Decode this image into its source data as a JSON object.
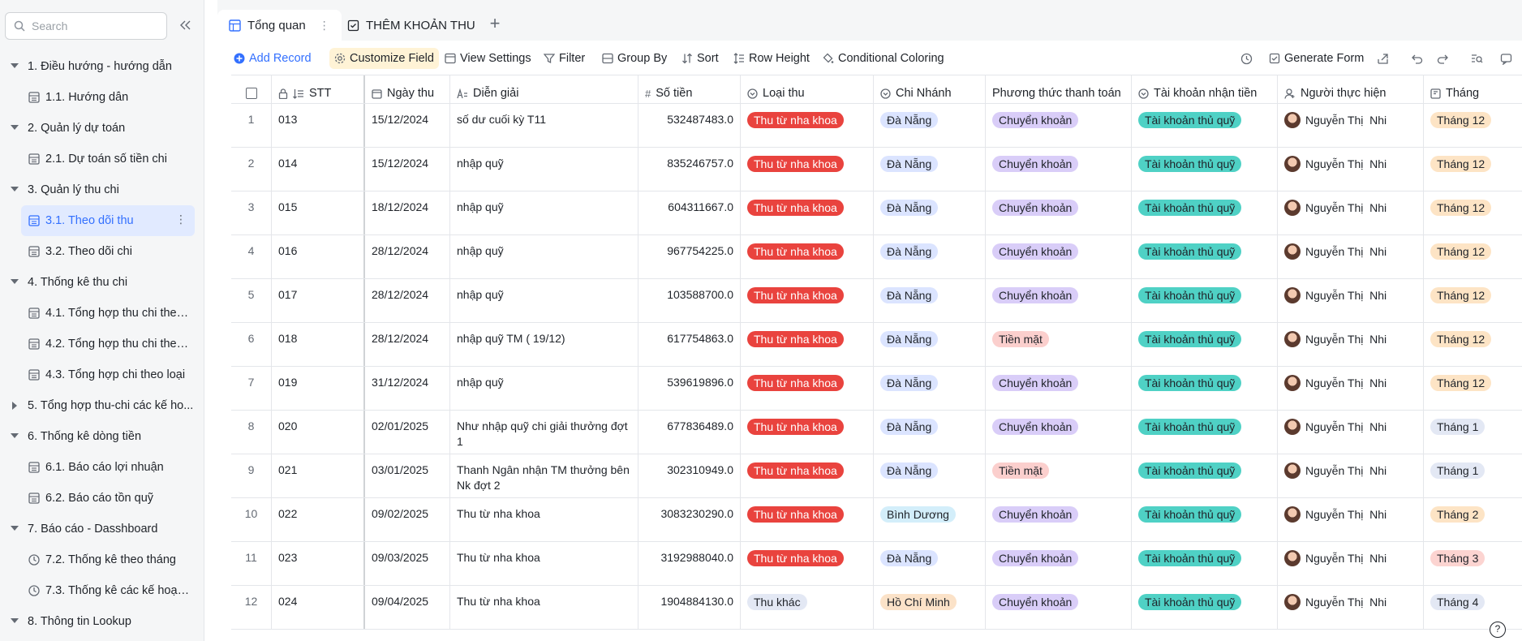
{
  "sidebar": {
    "search_placeholder": "Search",
    "items": [
      {
        "type": "group",
        "label": "1. Điều hướng - hướng dẫn",
        "expanded": true
      },
      {
        "type": "child",
        "label": "1.1. Hướng dẫn",
        "icon": "grid-icon"
      },
      {
        "type": "group",
        "label": "2. Quản lý dự toán",
        "expanded": true
      },
      {
        "type": "child",
        "label": "2.1. Dự toán số tiền chi",
        "icon": "grid-icon"
      },
      {
        "type": "group",
        "label": "3. Quản lý thu chi",
        "expanded": true
      },
      {
        "type": "child",
        "label": "3.1. Theo dõi thu",
        "icon": "grid-icon",
        "active": true
      },
      {
        "type": "child",
        "label": "3.2. Theo dõi chi",
        "icon": "grid-icon"
      },
      {
        "type": "group",
        "label": "4. Thống kê thu chi",
        "expanded": true
      },
      {
        "type": "child",
        "label": "4.1. Tổng hợp thu chi theo...",
        "icon": "grid-icon"
      },
      {
        "type": "child",
        "label": "4.2. Tổng hợp thu chi theo...",
        "icon": "grid-icon"
      },
      {
        "type": "child",
        "label": "4.3. Tổng hợp chi theo loại",
        "icon": "grid-icon"
      },
      {
        "type": "group",
        "label": "5. Tổng hợp thu-chi các kế ho...",
        "expanded": false
      },
      {
        "type": "group",
        "label": "6. Thống kê dòng tiền",
        "expanded": true
      },
      {
        "type": "child",
        "label": "6.1. Báo cáo lợi nhuận",
        "icon": "grid-icon"
      },
      {
        "type": "child",
        "label": "6.2. Báo cáo tồn quỹ",
        "icon": "grid-icon"
      },
      {
        "type": "group",
        "label": "7. Báo cáo - Dasshboard",
        "expanded": true
      },
      {
        "type": "child",
        "label": "7.2. Thống kê theo tháng",
        "icon": "dashboard-icon"
      },
      {
        "type": "child",
        "label": "7.3. Thống kê các kế hoạc...",
        "icon": "dashboard-icon"
      },
      {
        "type": "group",
        "label": "8. Thông tin Lookup",
        "expanded": true
      }
    ]
  },
  "tabs": [
    {
      "label": "Tổng quan",
      "active": true
    },
    {
      "label": "THÊM KHOẢN THU",
      "active": false
    }
  ],
  "toolbar": {
    "add_record": "Add Record",
    "customize_field": "Customize Field",
    "view_settings": "View Settings",
    "filter": "Filter",
    "group_by": "Group By",
    "sort": "Sort",
    "row_height": "Row Height",
    "conditional_coloring": "Conditional Coloring",
    "generate_form": "Generate Form"
  },
  "table": {
    "columns": [
      "STT",
      "Ngày thu",
      "Diễn giải",
      "Số tiền",
      "Loại thu",
      "Chi Nhánh",
      "Phương thức thanh toán",
      "Tài khoản nhận tiền",
      "Người thực hiện",
      "Tháng"
    ],
    "rows": [
      {
        "idx": "1",
        "stt": "013",
        "date": "15/12/2024",
        "desc": "số dư cuối kỳ T11",
        "amount": "532487483.0",
        "type": "Thu từ nha khoa",
        "branch": "Đà Nẵng",
        "method": "Chuyển khoản",
        "account": "Tài khoản thủ quỹ",
        "person": "Nguyễn Thị  Nhi",
        "month": "Tháng 12"
      },
      {
        "idx": "2",
        "stt": "014",
        "date": "15/12/2024",
        "desc": "nhập quỹ",
        "amount": "835246757.0",
        "type": "Thu từ nha khoa",
        "branch": "Đà Nẵng",
        "method": "Chuyển khoản",
        "account": "Tài khoản thủ quỹ",
        "person": "Nguyễn Thị  Nhi",
        "month": "Tháng 12"
      },
      {
        "idx": "3",
        "stt": "015",
        "date": "18/12/2024",
        "desc": "nhập quỹ",
        "amount": "604311667.0",
        "type": "Thu từ nha khoa",
        "branch": "Đà Nẵng",
        "method": "Chuyển khoản",
        "account": "Tài khoản thủ quỹ",
        "person": "Nguyễn Thị  Nhi",
        "month": "Tháng 12"
      },
      {
        "idx": "4",
        "stt": "016",
        "date": "28/12/2024",
        "desc": "nhập quỹ",
        "amount": "967754225.0",
        "type": "Thu từ nha khoa",
        "branch": "Đà Nẵng",
        "method": "Chuyển khoản",
        "account": "Tài khoản thủ quỹ",
        "person": "Nguyễn Thị  Nhi",
        "month": "Tháng 12"
      },
      {
        "idx": "5",
        "stt": "017",
        "date": "28/12/2024",
        "desc": "nhập quỹ",
        "amount": "103588700.0",
        "type": "Thu từ nha khoa",
        "branch": "Đà Nẵng",
        "method": "Chuyển khoản",
        "account": "Tài khoản thủ quỹ",
        "person": "Nguyễn Thị  Nhi",
        "month": "Tháng 12"
      },
      {
        "idx": "6",
        "stt": "018",
        "date": "28/12/2024",
        "desc": "nhập quỹ TM ( 19/12)",
        "amount": "617754863.0",
        "type": "Thu từ nha khoa",
        "branch": "Đà Nẵng",
        "method": "Tiền mặt",
        "account": "Tài khoản thủ quỹ",
        "person": "Nguyễn Thị  Nhi",
        "month": "Tháng 12"
      },
      {
        "idx": "7",
        "stt": "019",
        "date": "31/12/2024",
        "desc": "nhập quỹ",
        "amount": "539619896.0",
        "type": "Thu từ nha khoa",
        "branch": "Đà Nẵng",
        "method": "Chuyển khoản",
        "account": "Tài khoản thủ quỹ",
        "person": "Nguyễn Thị  Nhi",
        "month": "Tháng 12"
      },
      {
        "idx": "8",
        "stt": "020",
        "date": "02/01/2025",
        "desc": "Như nhập quỹ chi giải thưởng đợt 1",
        "amount": "677836489.0",
        "type": "Thu từ nha khoa",
        "branch": "Đà Nẵng",
        "method": "Chuyển khoản",
        "account": "Tài khoản thủ quỹ",
        "person": "Nguyễn Thị  Nhi",
        "month": "Tháng 1"
      },
      {
        "idx": "9",
        "stt": "021",
        "date": "03/01/2025",
        "desc": "Thanh Ngân nhận TM thưởng bên Nk đợt 2",
        "amount": "302310949.0",
        "type": "Thu từ nha khoa",
        "branch": "Đà Nẵng",
        "method": "Tiền mặt",
        "account": "Tài khoản thủ quỹ",
        "person": "Nguyễn Thị  Nhi",
        "month": "Tháng 1"
      },
      {
        "idx": "10",
        "stt": "022",
        "date": "09/02/2025",
        "desc": "Thu từ nha khoa",
        "amount": "3083230290.0",
        "type": "Thu từ nha khoa",
        "branch": "Bình Dương",
        "method": "Chuyển khoản",
        "account": "Tài khoản thủ quỹ",
        "person": "Nguyễn Thị  Nhi",
        "month": "Tháng 2"
      },
      {
        "idx": "11",
        "stt": "023",
        "date": "09/03/2025",
        "desc": "Thu từ nha khoa",
        "amount": "3192988040.0",
        "type": "Thu từ nha khoa",
        "branch": "Đà Nẵng",
        "method": "Chuyển khoản",
        "account": "Tài khoản thủ quỹ",
        "person": "Nguyễn Thị  Nhi",
        "month": "Tháng 3"
      },
      {
        "idx": "12",
        "stt": "024",
        "date": "09/04/2025",
        "desc": "Thu từ nha khoa",
        "amount": "1904884130.0",
        "type": "Thu khác",
        "branch": "Hồ Chí Minh",
        "method": "Chuyển khoản",
        "account": "Tài khoản thủ quỹ",
        "person": "Nguyễn Thị  Nhi",
        "month": "Tháng 4"
      }
    ]
  },
  "colors": {
    "accent": "#3370ff",
    "tag_red": "#e9433e",
    "tag_teal": "#4fd1c5",
    "tag_purple": "#d9cdf8"
  },
  "help_label": "?"
}
